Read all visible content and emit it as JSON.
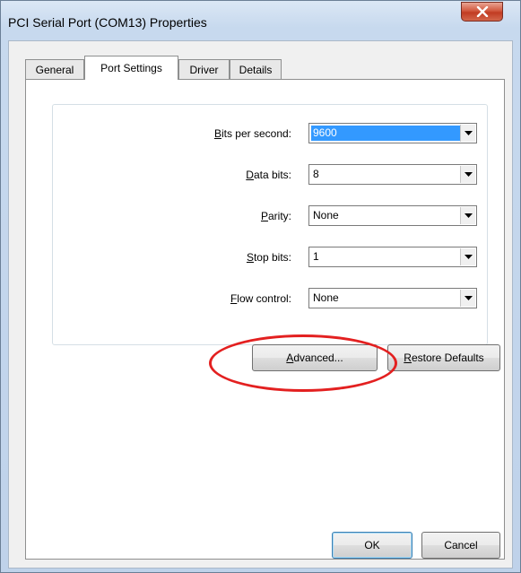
{
  "window": {
    "title": "PCI Serial Port (COM13) Properties",
    "close_icon": "close-icon"
  },
  "tabs": [
    {
      "label": "General",
      "active": false
    },
    {
      "label": "Port Settings",
      "active": true
    },
    {
      "label": "Driver",
      "active": false
    },
    {
      "label": "Details",
      "active": false
    }
  ],
  "settings": {
    "bits_per_second": {
      "label_mnemonic": "B",
      "label_rest": "its per second:",
      "value": "9600"
    },
    "data_bits": {
      "label_mnemonic": "D",
      "label_rest": "ata bits:",
      "value": "8"
    },
    "parity": {
      "label_mnemonic": "P",
      "label_rest": "arity:",
      "value": "None"
    },
    "stop_bits": {
      "label_mnemonic": "S",
      "label_rest": "top bits:",
      "value": "1"
    },
    "flow_control": {
      "label_mnemonic": "F",
      "label_rest": "low control:",
      "value": "None"
    }
  },
  "buttons": {
    "advanced_mnemonic": "A",
    "advanced_rest": "dvanced...",
    "restore_mnemonic": "R",
    "restore_rest": "estore Defaults",
    "ok": "OK",
    "cancel": "Cancel"
  },
  "colors": {
    "selection": "#3399ff",
    "annotation": "#e32020",
    "close_button": "#c13b22"
  }
}
